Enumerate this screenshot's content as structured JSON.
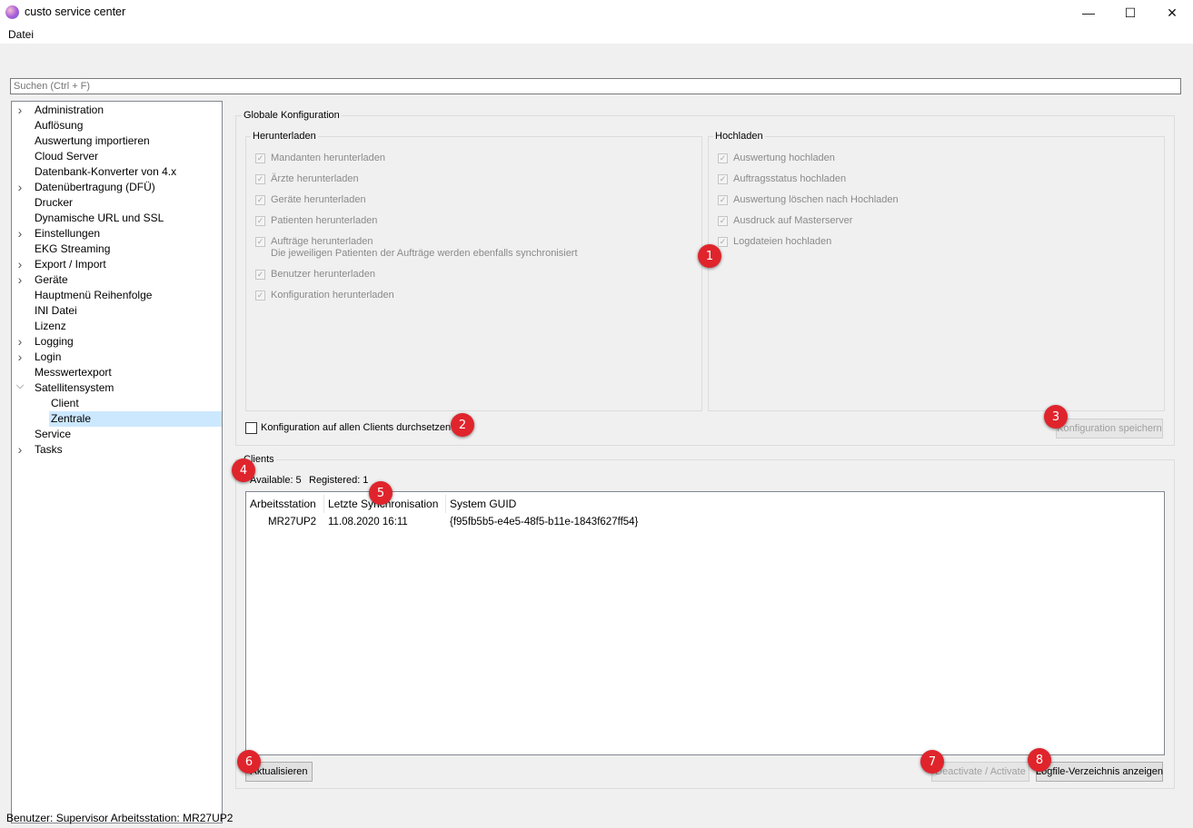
{
  "window": {
    "title": "custo service center",
    "controls": {
      "minimize": "—",
      "maximize": "☐",
      "close": "✕"
    }
  },
  "menu": {
    "items": [
      "Datei"
    ]
  },
  "search": {
    "placeholder": "Suchen (Ctrl + F)"
  },
  "tree": {
    "items": [
      {
        "label": "Administration",
        "expandable": true
      },
      {
        "label": "Auflösung",
        "expandable": false
      },
      {
        "label": "Auswertung importieren",
        "expandable": false
      },
      {
        "label": "Cloud Server",
        "expandable": false
      },
      {
        "label": "Datenbank-Konverter von 4.x",
        "expandable": false
      },
      {
        "label": "Datenübertragung (DFÜ)",
        "expandable": true
      },
      {
        "label": "Drucker",
        "expandable": false
      },
      {
        "label": "Dynamische URL und SSL",
        "expandable": false
      },
      {
        "label": "Einstellungen",
        "expandable": true
      },
      {
        "label": "EKG Streaming",
        "expandable": false
      },
      {
        "label": "Export / Import",
        "expandable": true
      },
      {
        "label": "Geräte",
        "expandable": true
      },
      {
        "label": "Hauptmenü Reihenfolge",
        "expandable": false
      },
      {
        "label": "INI Datei",
        "expandable": false
      },
      {
        "label": "Lizenz",
        "expandable": false
      },
      {
        "label": "Logging",
        "expandable": true
      },
      {
        "label": "Login",
        "expandable": true
      },
      {
        "label": "Messwertexport",
        "expandable": false
      },
      {
        "label": "Satellitensystem",
        "expandable": true,
        "expanded": true
      },
      {
        "label": "Client",
        "child": true
      },
      {
        "label": "Zentrale",
        "child": true,
        "selected": true
      },
      {
        "label": "Service",
        "expandable": false
      },
      {
        "label": "Tasks",
        "expandable": true
      }
    ]
  },
  "global_config": {
    "title": "Globale Konfiguration",
    "download": {
      "title": "Herunterladen",
      "items": [
        "Mandanten herunterladen",
        "Ärzte herunterladen",
        "Geräte herunterladen",
        "Patienten herunterladen",
        "Aufträge herunterladen",
        "Benutzer herunterladen",
        "Konfiguration herunterladen"
      ],
      "note": "Die jeweiligen Patienten der Aufträge werden ebenfalls synchronisiert"
    },
    "upload": {
      "title": "Hochladen",
      "items": [
        "Auswertung hochladen",
        "Auftragsstatus hochladen",
        "Auswertung löschen nach Hochladen",
        "Ausdruck auf Masterserver",
        "Logdateien hochladen"
      ]
    },
    "enforce_label": "Konfiguration auf allen Clients durchsetzen",
    "save_label": "Konfiguration speichern"
  },
  "clients": {
    "title": "Clients",
    "available_label": "Available: 5",
    "registered_label": "Registered: 1",
    "columns": [
      "Arbeitsstation",
      "Letzte Synchronisation",
      "System GUID"
    ],
    "rows": [
      {
        "station": "MR27UP2",
        "last_sync": "11.08.2020 16:11",
        "guid": "{f95fb5b5-e4e5-48f5-b11e-1843f627ff54}"
      }
    ],
    "refresh_label": "Aktualisieren",
    "toggle_label": "Deactivate / Activate",
    "logdir_label": "Logfile-Verzeichnis anzeigen"
  },
  "badges": [
    "1",
    "2",
    "3",
    "4",
    "5",
    "6",
    "7",
    "8"
  ],
  "status": {
    "text": "Benutzer: Supervisor Arbeitsstation: MR27UP2"
  },
  "colors": {
    "badge": "#e0242c",
    "selection": "#cce8ff"
  }
}
